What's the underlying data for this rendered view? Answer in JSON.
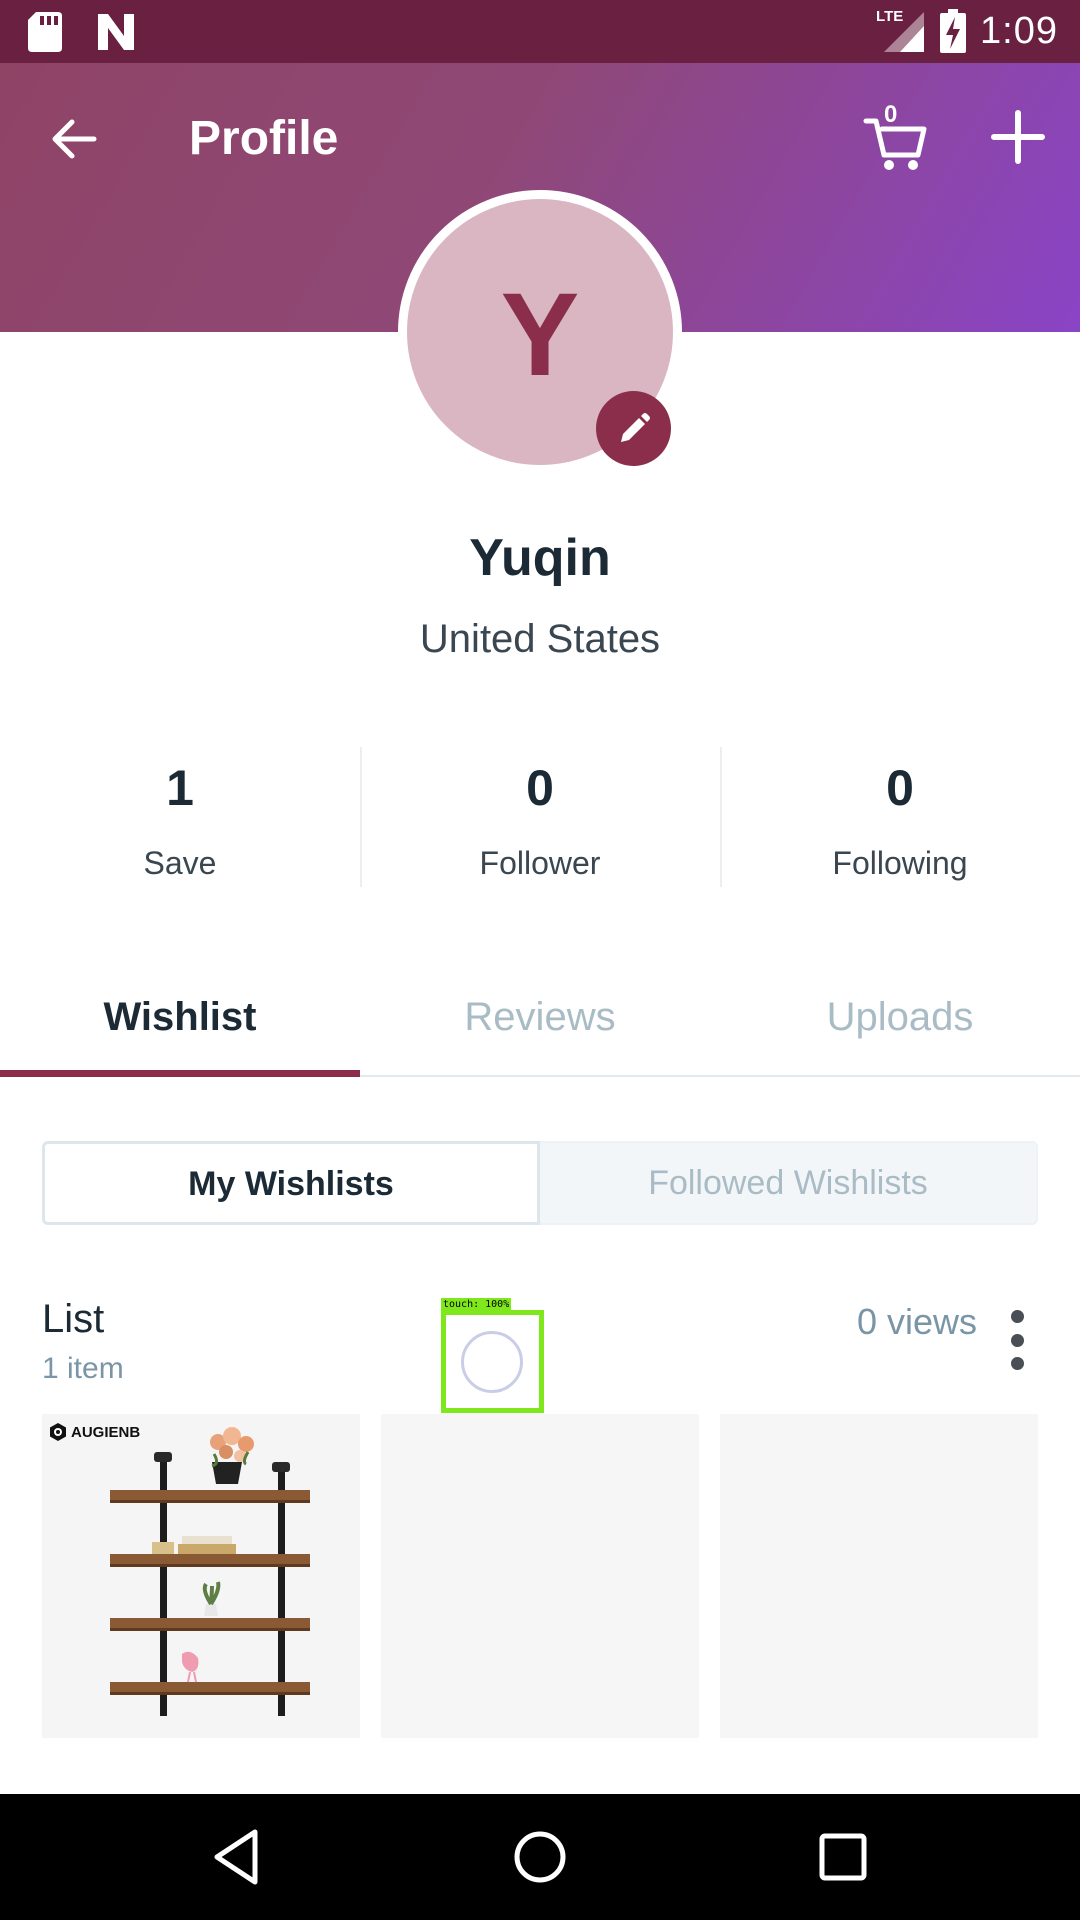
{
  "status_bar": {
    "network": "LTE",
    "time": "1:09"
  },
  "header": {
    "title": "Profile",
    "cart_count": "0"
  },
  "profile": {
    "initial": "Y",
    "name": "Yuqin",
    "location": "United States"
  },
  "stats": [
    {
      "value": "1",
      "label": "Save"
    },
    {
      "value": "0",
      "label": "Follower"
    },
    {
      "value": "0",
      "label": "Following"
    }
  ],
  "tabs": [
    {
      "label": "Wishlist",
      "active": true
    },
    {
      "label": "Reviews",
      "active": false
    },
    {
      "label": "Uploads",
      "active": false
    }
  ],
  "segmented": {
    "left": "My Wishlists",
    "right": "Followed Wishlists"
  },
  "list": {
    "title": "List",
    "count": "1 item",
    "views": "0 views",
    "brand": "AUGIENB"
  },
  "overlay": {
    "touch_label": "touch: 100%"
  },
  "colors": {
    "accent": "#8b2e4c",
    "status_bar": "#6a2040",
    "header_start": "#8f4466",
    "header_end": "#8a44c6"
  }
}
